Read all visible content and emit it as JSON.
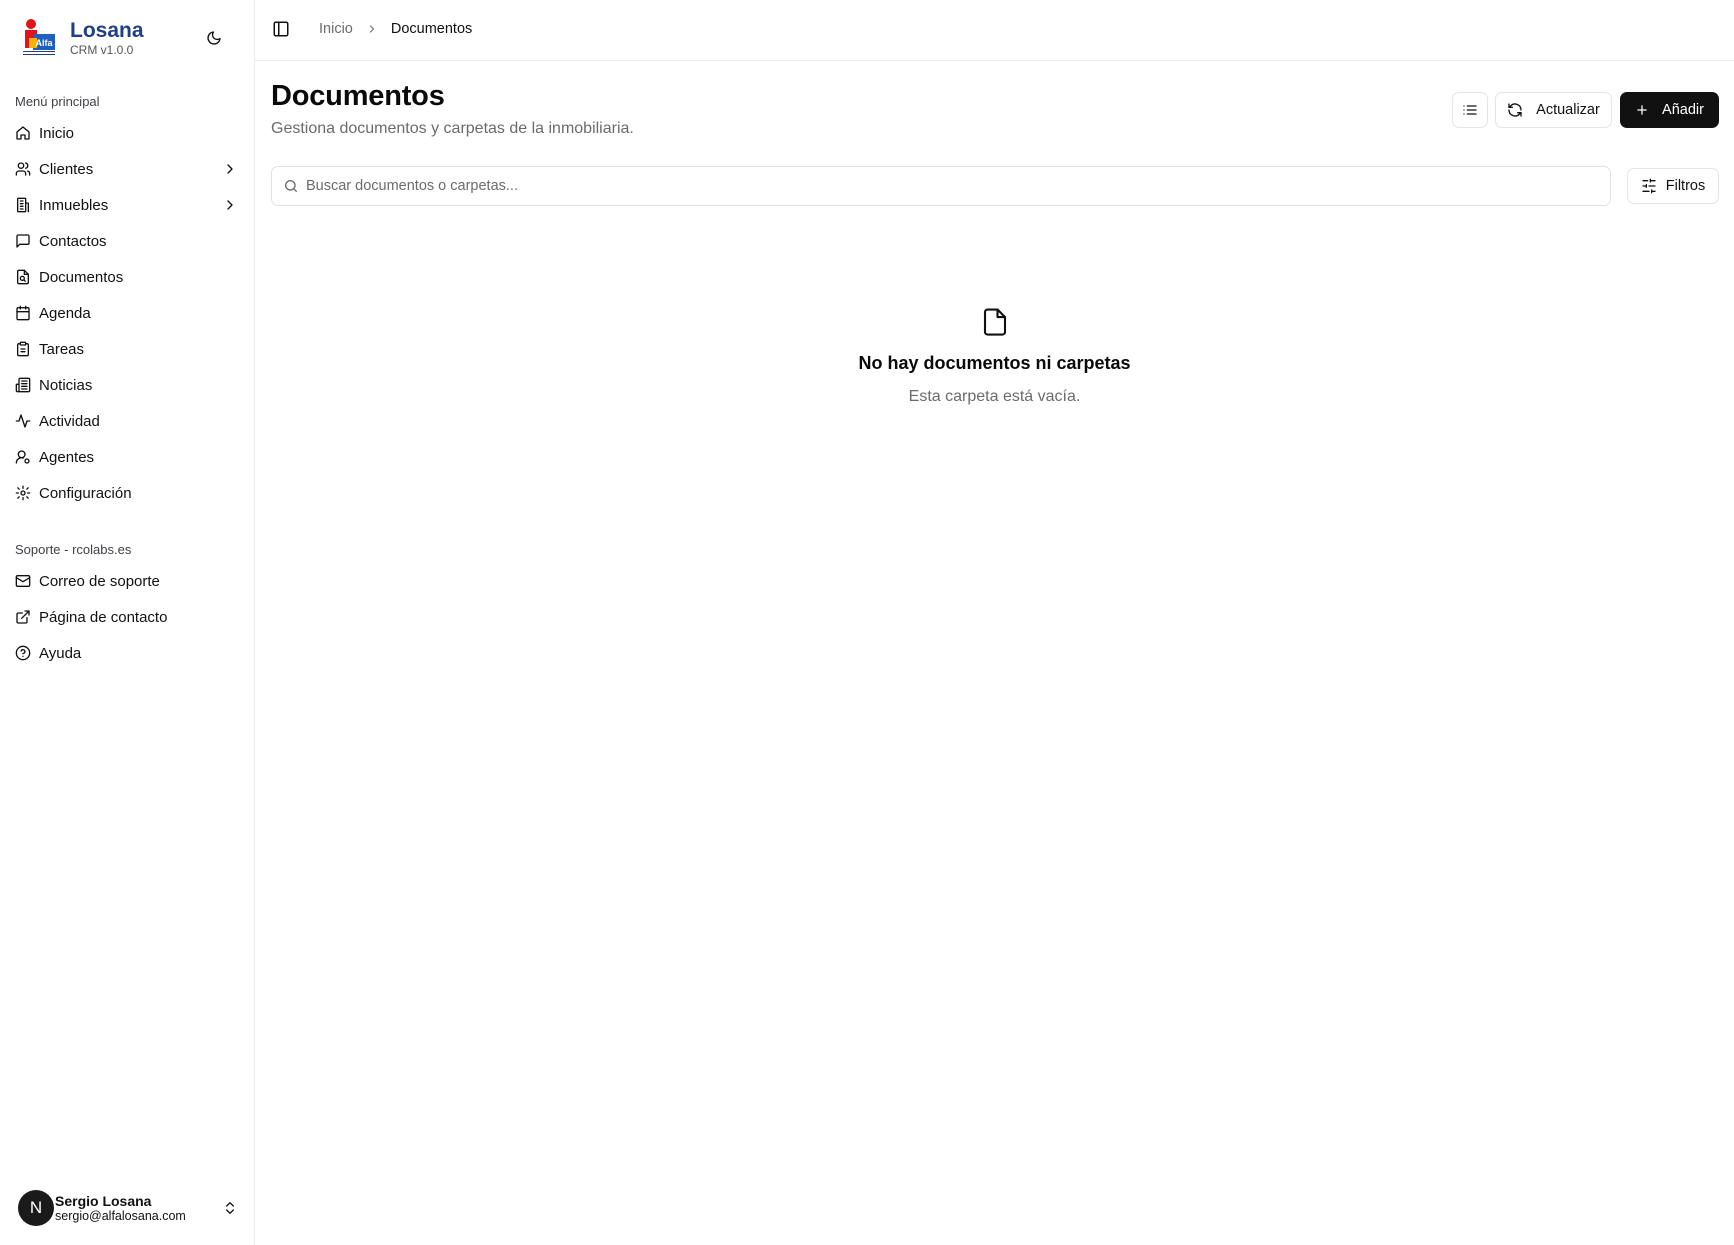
{
  "brand": {
    "name": "Losana",
    "version": "CRM v1.0.0",
    "logo_text": "Alfa"
  },
  "sidebar": {
    "main_label": "Menú principal",
    "items": [
      {
        "label": "Inicio",
        "icon": "home-icon"
      },
      {
        "label": "Clientes",
        "icon": "users-icon",
        "expandable": true
      },
      {
        "label": "Inmuebles",
        "icon": "building-icon",
        "expandable": true
      },
      {
        "label": "Contactos",
        "icon": "message-icon"
      },
      {
        "label": "Documentos",
        "icon": "file-search-icon"
      },
      {
        "label": "Agenda",
        "icon": "calendar-icon"
      },
      {
        "label": "Tareas",
        "icon": "clipboard-icon"
      },
      {
        "label": "Noticias",
        "icon": "newspaper-icon"
      },
      {
        "label": "Actividad",
        "icon": "activity-icon"
      },
      {
        "label": "Agentes",
        "icon": "user-cog-icon"
      },
      {
        "label": "Configuración",
        "icon": "gear-icon"
      }
    ],
    "support_label": "Soporte - rcolabs.es",
    "support_items": [
      {
        "label": "Correo de soporte",
        "icon": "mail-icon"
      },
      {
        "label": "Página de contacto",
        "icon": "external-link-icon"
      },
      {
        "label": "Ayuda",
        "icon": "help-circle-icon"
      }
    ]
  },
  "user": {
    "initial": "N",
    "name": "Sergio Losana",
    "email": "sergio@alfalosana.com"
  },
  "breadcrumb": {
    "home": "Inicio",
    "current": "Documentos"
  },
  "page": {
    "title": "Documentos",
    "subtitle": "Gestiona documentos y carpetas de la inmobiliaria."
  },
  "toolbar": {
    "refresh_label": "Actualizar",
    "add_label": "Añadir",
    "filters_label": "Filtros"
  },
  "search": {
    "placeholder": "Buscar documentos o carpetas...",
    "value": ""
  },
  "empty_state": {
    "title": "No hay documentos ni carpetas",
    "text": "Esta carpeta está vacía."
  },
  "colors": {
    "brand": "#1f3f86",
    "primary_button": "#111111",
    "muted_text": "#6b6b6b",
    "border": "#e5e5e5"
  }
}
